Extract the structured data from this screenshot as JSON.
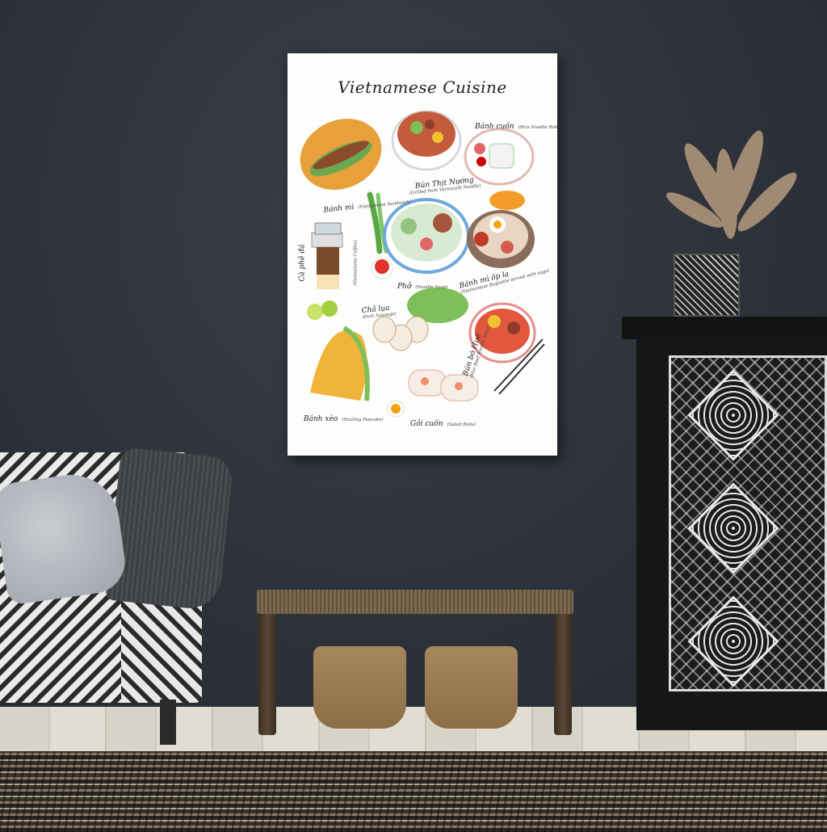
{
  "poster": {
    "title": "Vietnamese Cuisine",
    "labels": [
      {
        "main": "Bánh mì",
        "sub": "(Vietnamese Sandwich)"
      },
      {
        "main": "Bún Thịt Nướng",
        "sub": "(Grilled Pork Vermicelli Noodle)"
      },
      {
        "main": "Bánh cuốn",
        "sub": "(Rice Noodle Roll)"
      },
      {
        "main": "Cà phê đá",
        "sub": "(Vietnamese Coffee)"
      },
      {
        "main": "Phở",
        "sub": "(Noodle Soup)"
      },
      {
        "main": "Bánh mì ốp la",
        "sub": "(Vietnamese Baguette served with eggs)"
      },
      {
        "main": "Chả lụa",
        "sub": "(Pork Sausage)"
      },
      {
        "main": "Bún bò Huế",
        "sub": "(Hue Beef Noodle Soup)"
      },
      {
        "main": "Bánh xèo",
        "sub": "(Sizzling Pancake)"
      },
      {
        "main": "Gỏi cuốn",
        "sub": "(Salad Rolls)"
      }
    ]
  },
  "colors": {
    "wall": "#2e323a",
    "poster_bg": "#fdfdfb",
    "cabinet": "#151617",
    "bench": "#6b5a42",
    "basket": "#9a7a50"
  }
}
